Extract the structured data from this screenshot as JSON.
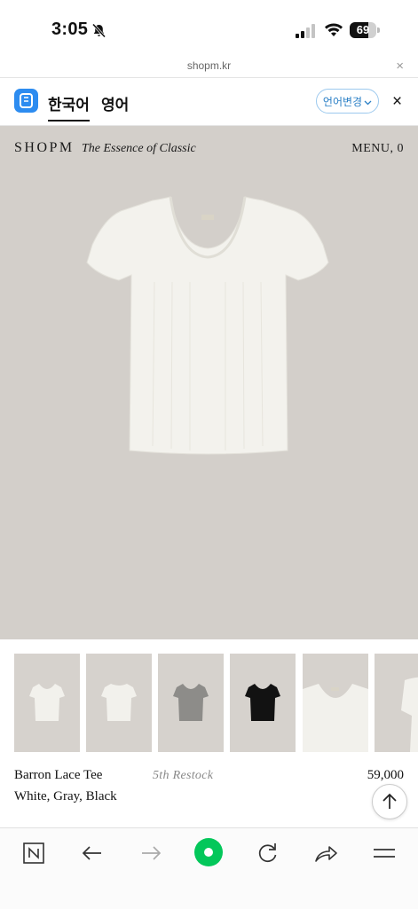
{
  "status_bar": {
    "time": "3:05",
    "battery": "69",
    "battery_level_percent": 69
  },
  "url_bar": {
    "url": "shopm.kr",
    "close_glyph": "×"
  },
  "translate_bar": {
    "tab_korean": "한국어",
    "tab_english": "영어",
    "change_language": "언어변경",
    "close_glyph": "×"
  },
  "header": {
    "brand": "SHOPM",
    "tagline": "The Essence of Classic",
    "menu": "MENU, 0"
  },
  "product": {
    "name": "Barron Lace Tee",
    "restock_note": "5th Restock",
    "price": "59,000",
    "colors": "White, Gray, Black"
  },
  "thumbnails": [
    {
      "name": "thumb-white-front",
      "shirt_color": "#f2f1ec"
    },
    {
      "name": "thumb-white-back",
      "shirt_color": "#f2f1ec"
    },
    {
      "name": "thumb-gray",
      "shirt_color": "#8d8c89"
    },
    {
      "name": "thumb-black",
      "shirt_color": "#121212"
    },
    {
      "name": "thumb-neck-detail",
      "shirt_color": "#f2f1ec"
    },
    {
      "name": "thumb-sleeve-detail",
      "shirt_color": "#f2f1ec"
    }
  ],
  "colors": {
    "hero_background": "#d3cfca",
    "accent_green": "#03c75a",
    "translate_blue": "#2d8cf0"
  },
  "icons": {
    "status": [
      "bell-slash-icon",
      "signal-icon",
      "wifi-icon",
      "battery-icon"
    ],
    "bottom_nav": [
      "naver-logo-icon",
      "back-arrow-icon",
      "forward-arrow-icon",
      "home-green-icon",
      "refresh-icon",
      "share-icon",
      "menu-icon"
    ],
    "scroll_top": "arrow-up-icon"
  }
}
